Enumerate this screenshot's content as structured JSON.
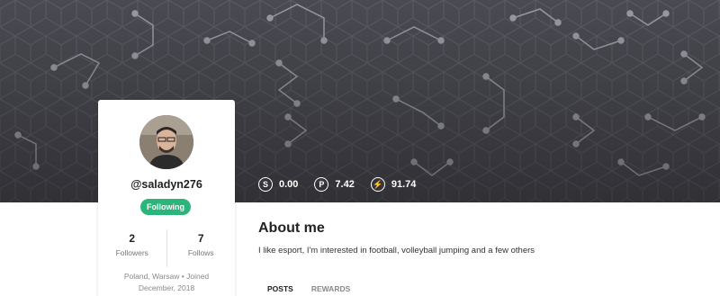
{
  "profile": {
    "username": "@saladyn276",
    "follow_button_label": "Following",
    "followers_count": "2",
    "followers_label": "Followers",
    "follows_count": "7",
    "follows_label": "Follows",
    "location_joined": "Poland, Warsaw • Joined December, 2018"
  },
  "balances": [
    {
      "icon": "S",
      "icon_name": "steem-coin-icon",
      "value": "0.00"
    },
    {
      "icon": "P",
      "icon_name": "power-icon",
      "value": "7.42"
    },
    {
      "icon": "⚡",
      "icon_name": "lightning-icon",
      "value": "91.74"
    }
  ],
  "about": {
    "title": "About me",
    "text": "I like esport, I'm interested in football, volleyball jumping and a few others"
  },
  "tabs": [
    {
      "label": "POSTS",
      "active": true
    },
    {
      "label": "REWARDS",
      "active": false
    }
  ],
  "colors": {
    "cover": "#4a4a52",
    "follow_button": "#2bb57a"
  }
}
